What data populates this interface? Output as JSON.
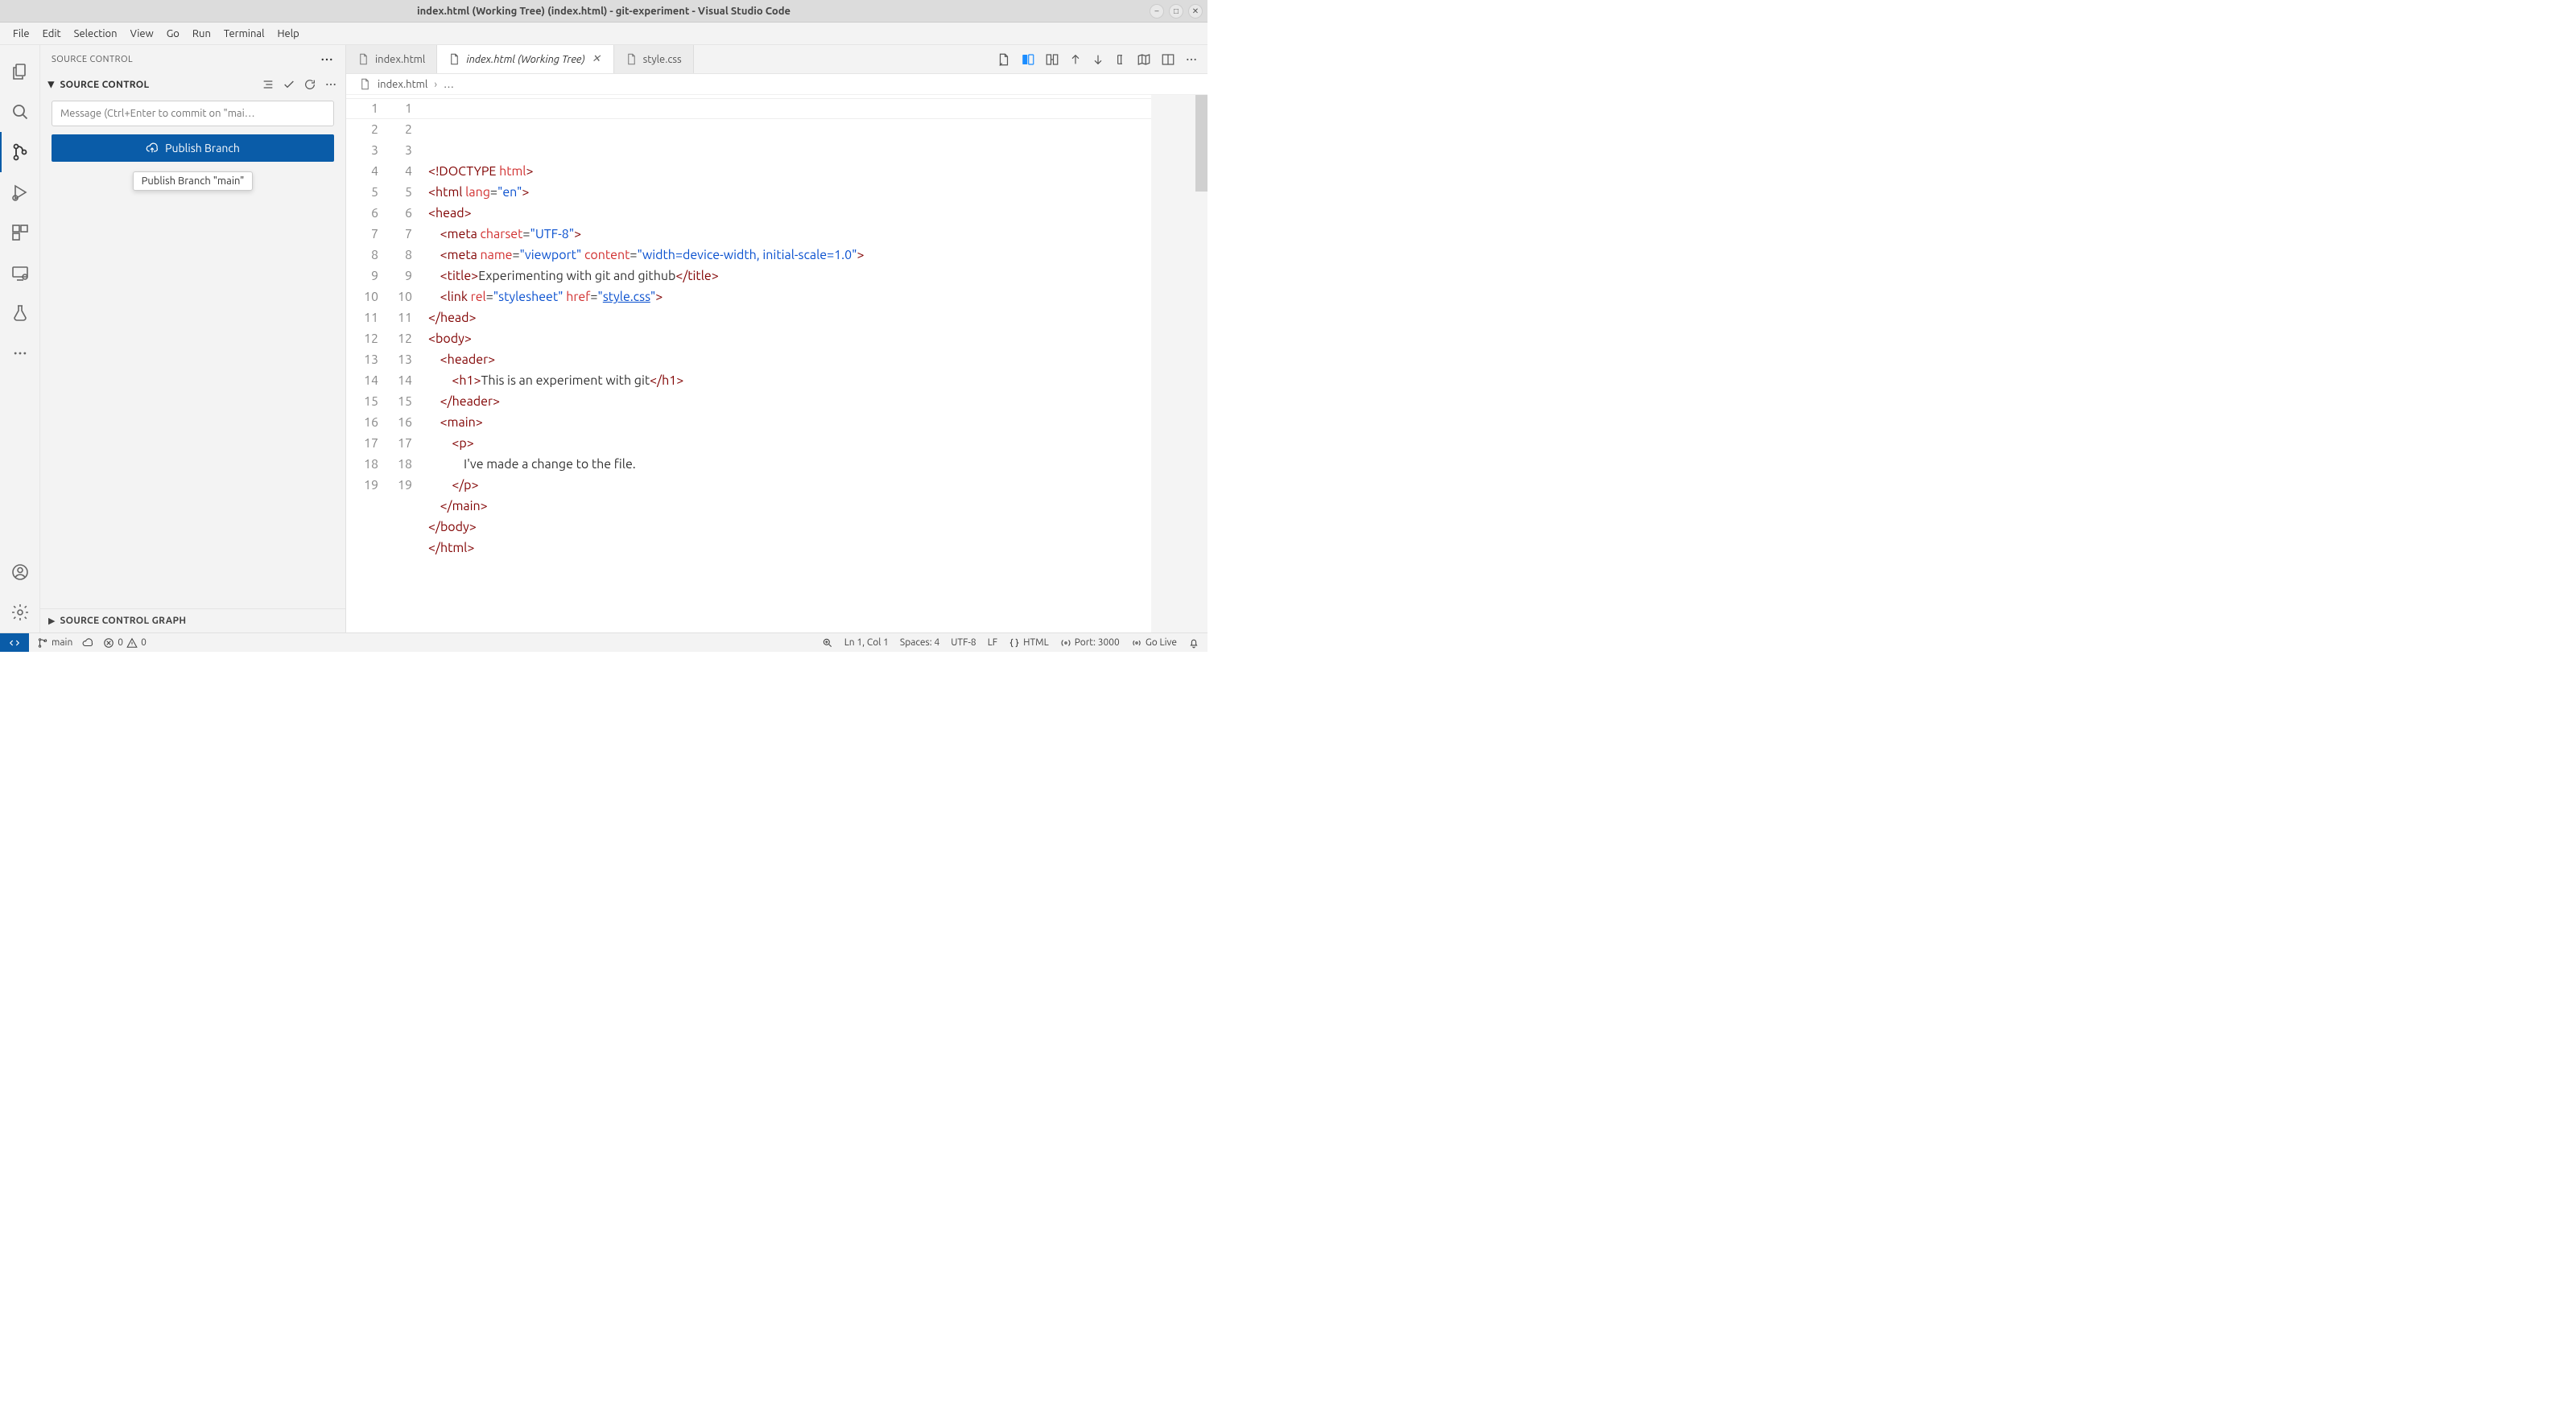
{
  "window": {
    "title": "index.html (Working Tree) (index.html) - git-experiment - Visual Studio Code"
  },
  "menu": [
    "File",
    "Edit",
    "Selection",
    "View",
    "Go",
    "Run",
    "Terminal",
    "Help"
  ],
  "sidebar": {
    "title": "SOURCE CONTROL",
    "section_title": "SOURCE CONTROL",
    "graph_title": "SOURCE CONTROL GRAPH",
    "commit_placeholder": "Message (Ctrl+Enter to commit on \"mai…",
    "publish_label": "Publish Branch",
    "tooltip": "Publish Branch \"main\""
  },
  "tabs": {
    "t1": "index.html",
    "t2": "index.html (Working Tree)",
    "t3": "style.css"
  },
  "breadcrumb": {
    "file": "index.html",
    "rest": "…"
  },
  "status": {
    "branch": "main",
    "errors": "0",
    "warnings": "0",
    "pos": "Ln 1, Col 1",
    "spaces": "Spaces: 4",
    "encoding": "UTF-8",
    "eol": "LF",
    "lang": "HTML",
    "port": "Port: 3000",
    "live": "Go Live"
  },
  "lines": {
    "left": [
      "1",
      "2",
      "3",
      "4",
      "5",
      "6",
      "7",
      "8",
      "9",
      "10",
      "11",
      "12",
      "13",
      "14",
      "15",
      "16",
      "17",
      "18",
      "19"
    ],
    "right": [
      "1",
      "2",
      "3",
      "4",
      "5",
      "6",
      "7",
      "8",
      "9",
      "10",
      "11",
      "12",
      "13",
      "14",
      "15",
      "16",
      "17",
      "18",
      "19"
    ]
  },
  "code": {
    "doctype_l": "<!DOCTYPE ",
    "doctype_r": "html",
    "doctype_end": ">",
    "html_open_l": "<html ",
    "lang_attr": "lang",
    "eq": "=",
    "lang_val": "\"en\"",
    "close": ">",
    "head_open": "<head>",
    "head_close": "</head>",
    "meta1_l": "<meta ",
    "charset_attr": "charset",
    "charset_val": "\"UTF-8\"",
    "meta2_l": "<meta ",
    "name_attr": "name",
    "name_val": "\"viewport\"",
    "content_attr": "content",
    "content_val": "\"width=device-width, initial-scale=1.0\"",
    "title_open": "<title>",
    "title_text": "Experimenting with git and github",
    "title_close": "</title>",
    "link_l": "<link ",
    "rel_attr": "rel",
    "rel_val": "\"stylesheet\"",
    "href_attr": "href",
    "href_q": "\"",
    "href_val": "style.css",
    "body_open": "<body>",
    "body_close": "</body>",
    "header_open": "<header>",
    "header_close": "</header>",
    "h1_open": "<h1>",
    "h1_text": "This is an experiment with git",
    "h1_close": "</h1>",
    "main_open": "<main>",
    "main_close": "</main>",
    "p_open": "<p>",
    "p_text": "I've made a change to the file.",
    "p_close": "</p>",
    "html_close": "</html>"
  }
}
